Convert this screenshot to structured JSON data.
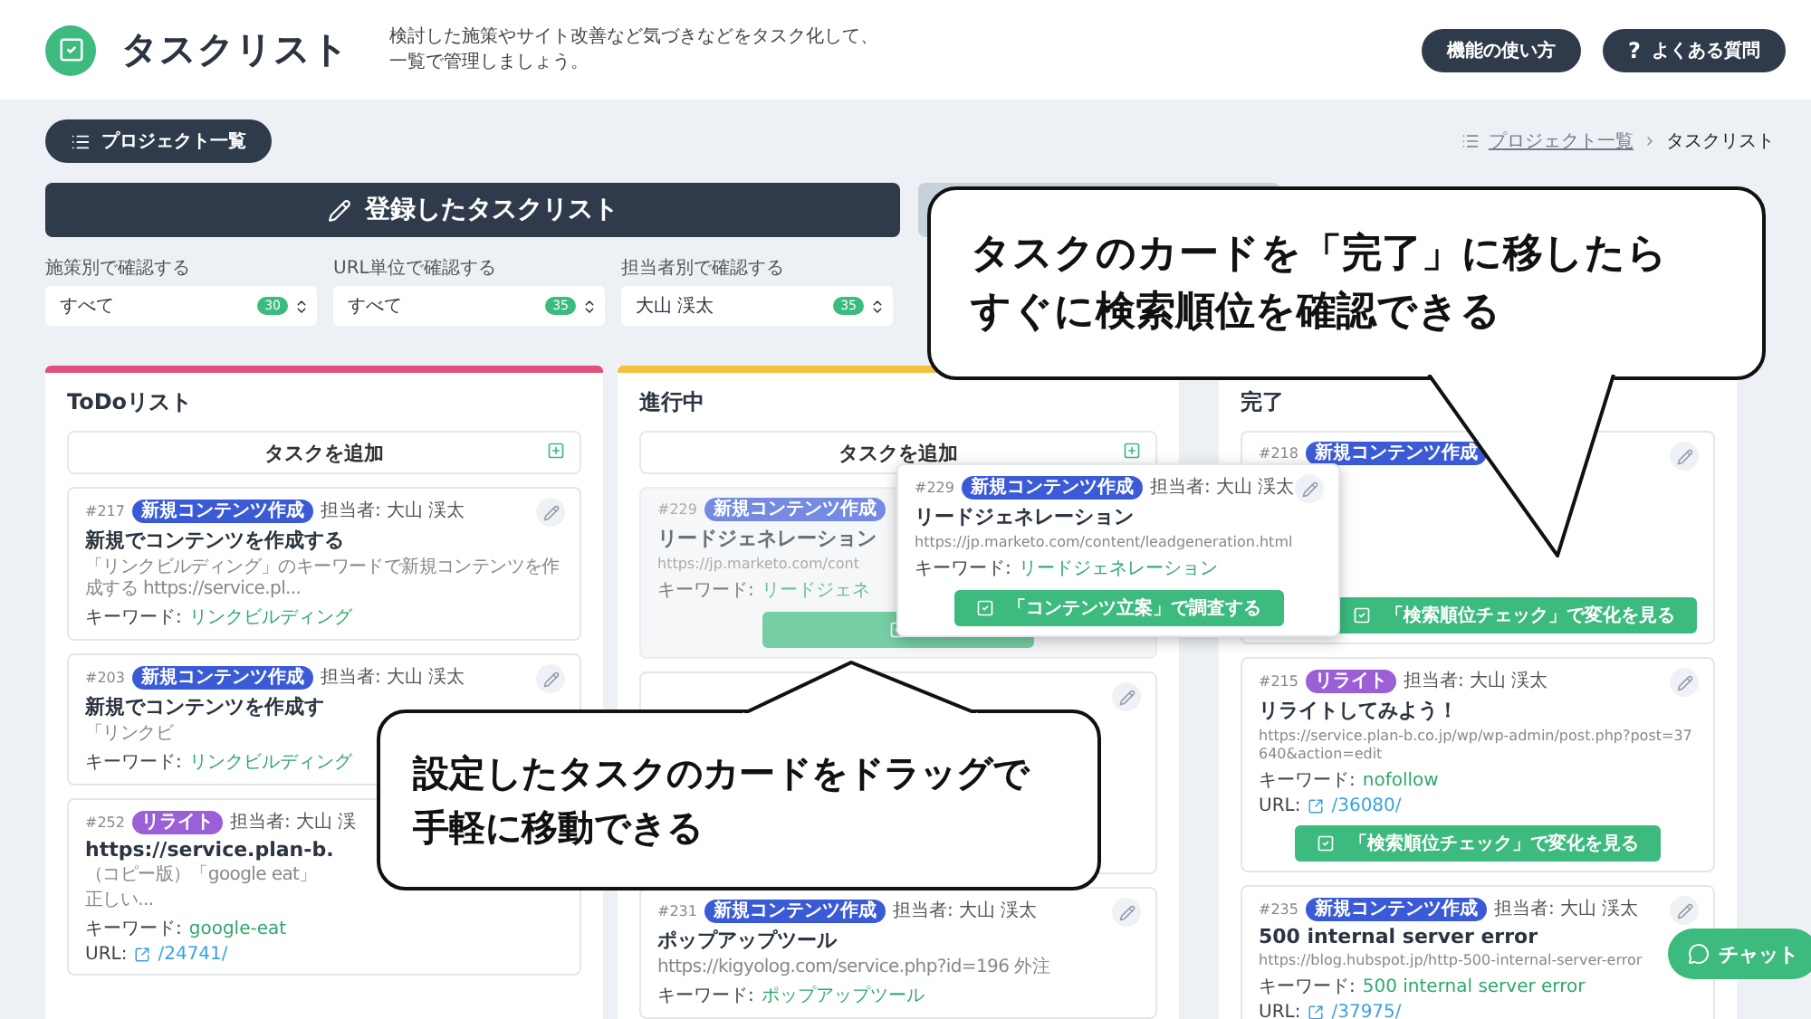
{
  "header": {
    "title": "タスクリスト",
    "description": [
      "検討した施策やサイト改善など気づきなどをタスク化して、",
      "一覧で管理しましょう。"
    ],
    "buttons": [
      {
        "label": "機能の使い方"
      },
      {
        "icon": "?",
        "label": "よくある質問"
      }
    ]
  },
  "toolbar": {
    "project_button": "プロジェクト一覧",
    "breadcrumb": [
      {
        "label": "プロジェクト一覧",
        "link": true
      },
      {
        "label": "タスクリスト",
        "link": false
      }
    ]
  },
  "tabs": [
    {
      "label": "登録したタスクリスト",
      "selected": true
    },
    {
      "selected": false
    }
  ],
  "filters": [
    {
      "label": "施策別で確認する",
      "value": "すべて",
      "count": "30"
    },
    {
      "label": "URL単位で確認する",
      "value": "すべて",
      "count": "35"
    },
    {
      "label": "担当者別で確認する",
      "value": "大山 渓太",
      "count": "35"
    }
  ],
  "columns": [
    {
      "title": "ToDoリスト",
      "color": "#e2507a",
      "add_label": "タスクを追加",
      "cards": [
        {
          "kind": "normal",
          "edit": true,
          "number": "#217",
          "tag": {
            "label": "新規コンテンツ作成",
            "kind": "new"
          },
          "assignee": "担当者: 大山 渓太",
          "title": "新規でコンテンツを作成する",
          "desc": "「リンクビルディング」のキーワードで新規コンテンツを作成する https://service.pl...",
          "keyword_label": "キーワード:",
          "keyword": "リンクビルディング"
        },
        {
          "kind": "normal",
          "edit": true,
          "number": "#203",
          "tag": {
            "label": "新規コンテンツ作成",
            "kind": "new"
          },
          "assignee": "担当者: 大山 渓太",
          "title": "新規でコンテンツを作成す",
          "desc": "「リンクビ",
          "keyword_label": "キーワード:",
          "keyword": "リンクビルディング"
        },
        {
          "kind": "normal",
          "number": "#252",
          "tag": {
            "label": "リライト",
            "kind": "rewrite"
          },
          "assignee": "担当者: 大山 渓",
          "title": "https://service.plan-b.",
          "desc": "（コピー版）「google eat」",
          "desc_next": "正しい...",
          "keyword_label": "キーワード:",
          "keyword": "google-eat",
          "url_label": "URL:",
          "url": "/24741/"
        }
      ]
    },
    {
      "title": "進行中",
      "color": "#f2c23c",
      "add_label": "タスクを追加",
      "cards": [
        {
          "kind": "ghost",
          "number": "#229",
          "tag": {
            "label": "新規コンテンツ作成",
            "kind": "new"
          },
          "title": "リードジェネレーション",
          "address": "https://jp.marketo.com/cont",
          "keyword_label": "キーワード:",
          "keyword": "リードジェネ",
          "action_icon": true
        },
        {
          "kind": "covered",
          "edit": true
        },
        {
          "kind": "normal",
          "edit": true,
          "number": "#231",
          "tag": {
            "label": "新規コンテンツ作成",
            "kind": "new"
          },
          "assignee": "担当者: 大山 渓太",
          "title": "ポップアップツール",
          "desc": "https://kigyolog.com/service.php?id=196 外注",
          "keyword_label": "キーワード:",
          "keyword": "ポップアップツール"
        }
      ]
    },
    {
      "title": "完了",
      "cards": [
        {
          "kind": "partial",
          "edit": true,
          "number": "#218",
          "tag": {
            "label": "新規コンテンツ作成",
            "kind": "new"
          },
          "action": "「検索順位チェック」で変化を見る"
        },
        {
          "kind": "normal",
          "edit": true,
          "number": "#215",
          "tag": {
            "label": "リライト",
            "kind": "rewrite"
          },
          "assignee": "担当者: 大山 渓太",
          "title": "リライトしてみよう！",
          "address": "https://service.plan-b.co.jp/wp/wp-admin/post.php?post=37640&action=edit",
          "keyword_label": "キーワード:",
          "keyword": "nofollow",
          "url_label": "URL:",
          "url": "/36080/",
          "action": "「検索順位チェック」で変化を見る"
        },
        {
          "kind": "normal",
          "edit": true,
          "number": "#235",
          "tag": {
            "label": "新規コンテンツ作成",
            "kind": "new"
          },
          "assignee": "担当者: 大山 渓太",
          "title": "500 internal server error",
          "address": "https://blog.hubspot.jp/http-500-internal-server-error",
          "keyword_label": "キーワード:",
          "keyword": "500 internal server error",
          "url_label": "URL:",
          "url": "/37975/"
        }
      ]
    }
  ],
  "dragged_card": {
    "kind": "normal",
    "edit": true,
    "number": "#229",
    "tag": {
      "label": "新規コンテンツ作成",
      "kind": "new"
    },
    "assignee": "担当者: 大山 渓太",
    "title": "リードジェネレーション",
    "address": "https://jp.marketo.com/content/leadgeneration.html",
    "keyword_label": "キーワード:",
    "keyword": "リードジェネレーション",
    "action": "「コンテンツ立案」で調査する"
  },
  "callouts": [
    {
      "lines": [
        "タスクのカードを「完了」に移したら",
        "すぐに検索順位を確認できる"
      ]
    },
    {
      "lines": [
        "設定したタスクのカードをドラッグで",
        "手軽に移動できる"
      ]
    }
  ],
  "chat_button": "チャット"
}
